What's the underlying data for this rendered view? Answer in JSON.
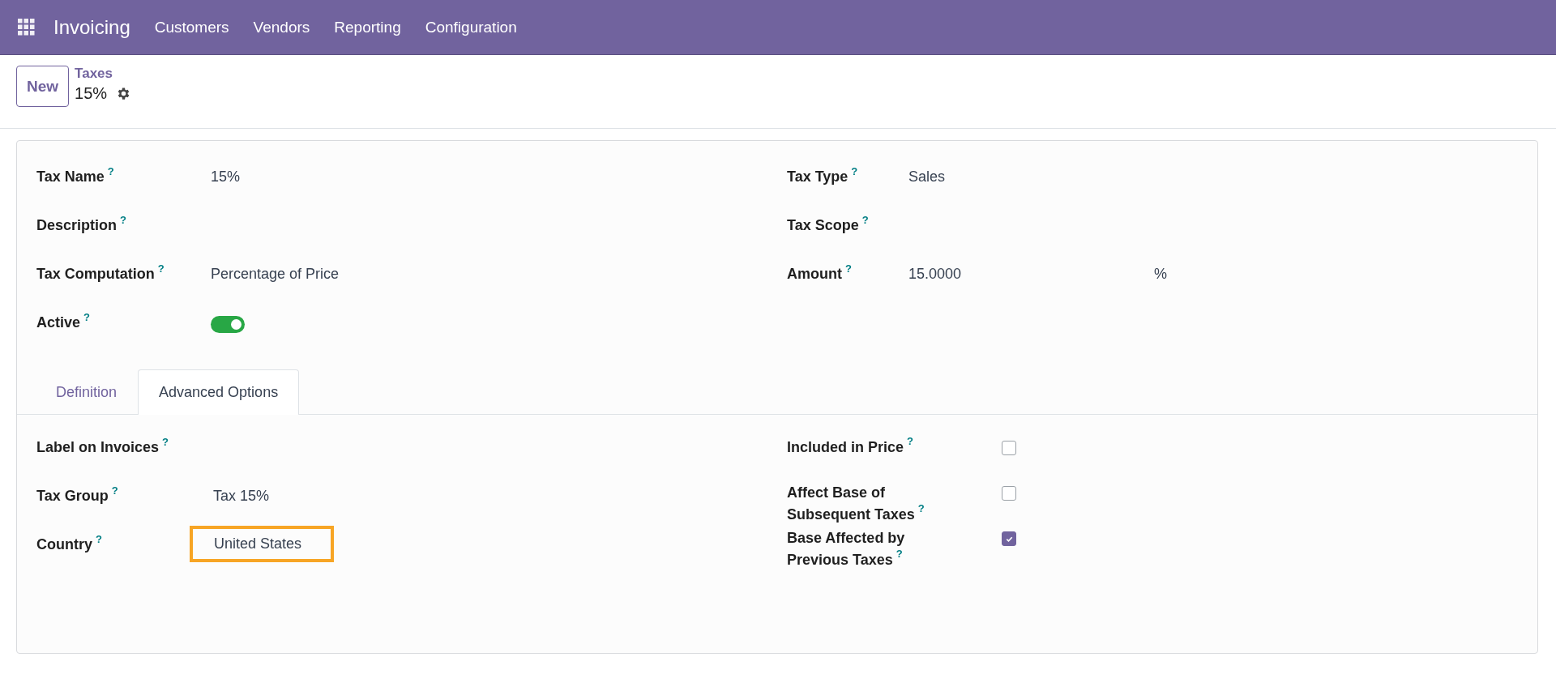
{
  "navbar": {
    "app_name": "Invoicing",
    "menu": [
      "Customers",
      "Vendors",
      "Reporting",
      "Configuration"
    ]
  },
  "control_panel": {
    "new_button": "New",
    "breadcrumb": "Taxes",
    "record": "15%"
  },
  "main_fields": {
    "left": [
      {
        "kind": "text",
        "label": "Tax Name",
        "help": "?",
        "value": "15%"
      },
      {
        "kind": "text",
        "label": "Description",
        "help": "?"
      },
      {
        "kind": "text",
        "label": "Tax Computation",
        "help": "?",
        "value": "Percentage of Price"
      },
      {
        "kind": "toggle",
        "label": "Active",
        "help": "?",
        "on": true
      }
    ],
    "right": [
      {
        "kind": "text",
        "label": "Tax Type",
        "help": "?",
        "value": "Sales"
      },
      {
        "kind": "text",
        "label": "Tax Scope",
        "help": "?"
      },
      {
        "kind": "amount",
        "label": "Amount",
        "help": "?",
        "value": "15.0000",
        "unit": "%"
      }
    ]
  },
  "tabs": [
    {
      "label": "Definition",
      "selected": false
    },
    {
      "label": "Advanced Options",
      "selected": true
    }
  ],
  "advanced": {
    "left": [
      {
        "kind": "text",
        "label": "Label on Invoices",
        "help": "?"
      },
      {
        "kind": "text",
        "label": "Tax Group",
        "help": "?",
        "value": "Tax 15%"
      },
      {
        "kind": "text",
        "label": "Country",
        "help": "?",
        "value": "United States",
        "highlighted": true
      }
    ],
    "right": [
      {
        "kind": "checkbox",
        "label": "Included in Price",
        "help": "?",
        "checked": false
      },
      {
        "kind": "checkbox",
        "label": "Affect Base of Subsequent Taxes",
        "help": "?",
        "checked": false
      },
      {
        "kind": "checkbox",
        "label": "Base Affected by Previous Taxes",
        "help": "?",
        "checked": true
      }
    ]
  }
}
